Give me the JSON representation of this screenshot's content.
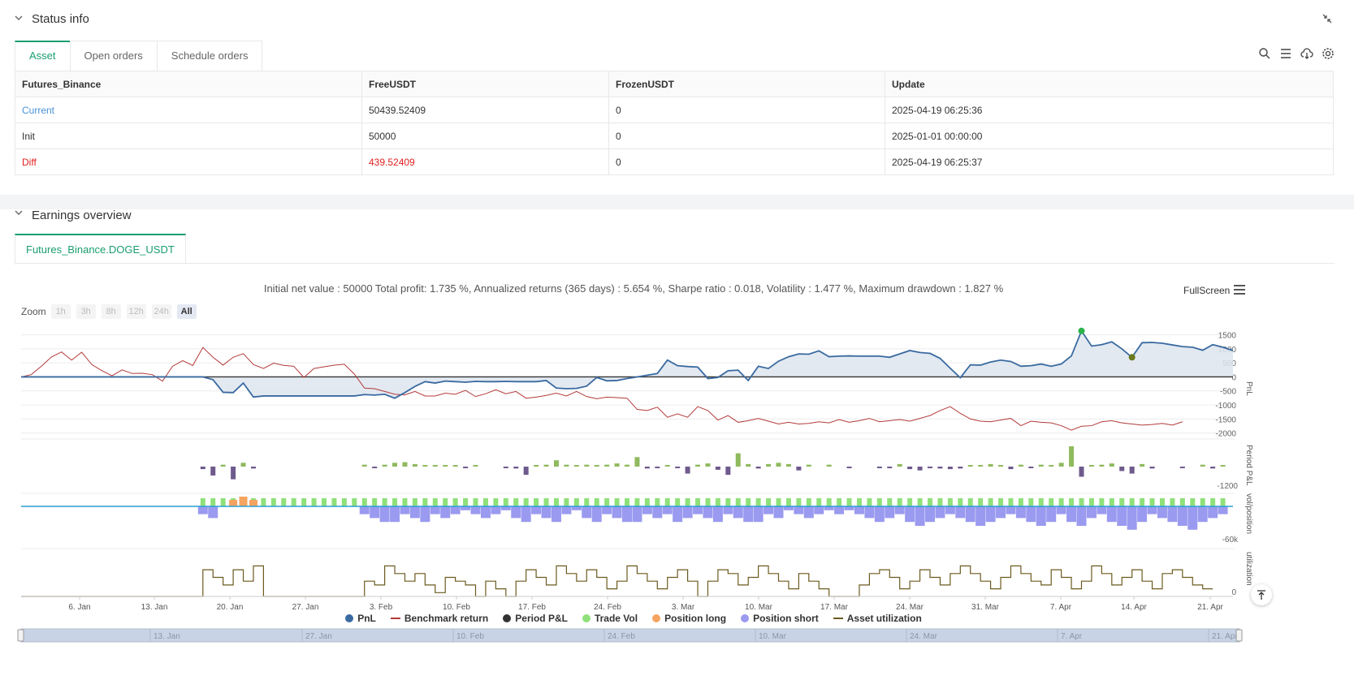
{
  "status": {
    "title": "Status info",
    "tabs": [
      "Asset",
      "Open orders",
      "Schedule orders"
    ],
    "table": {
      "headers": [
        "Futures_Binance",
        "FreeUSDT",
        "FrozenUSDT",
        "Update"
      ],
      "rows": [
        [
          "Current",
          "50439.52409",
          "0",
          "2025-04-19 06:25:36"
        ],
        [
          "Init",
          "50000",
          "0",
          "2025-01-01 00:00:00"
        ],
        [
          "Diff",
          "439.52409",
          "0",
          "2025-04-19 06:25:37"
        ]
      ]
    }
  },
  "earnings": {
    "title": "Earnings overview",
    "tab": "Futures_Binance.DOGE_USDT",
    "summary": "Initial net value : 50000 Total profit: 1.735 %, Annualized returns (365 days) : 5.654 %, Sharpe ratio : 0.018, Volatility : 1.477 %, Maximum drawdown : 1.827 %",
    "fullscreen": "FullScreen",
    "zoom_label": "Zoom",
    "zoom_buttons": [
      "1h",
      "3h",
      "8h",
      "12h",
      "24h",
      "All"
    ]
  },
  "chart_data": {
    "type": "line",
    "x_labels": [
      "6. Jan",
      "13. Jan",
      "20. Jan",
      "27. Jan",
      "3. Feb",
      "10. Feb",
      "17. Feb",
      "24. Feb",
      "3. Mar",
      "10. Mar",
      "17. Mar",
      "24. Mar",
      "31. Mar",
      "7. Apr",
      "14. Apr",
      "21. Apr"
    ],
    "navigator_labels": [
      "13. Jan",
      "27. Jan",
      "10. Feb",
      "24. Feb",
      "10. Mar",
      "24. Mar",
      "7. Apr",
      "21. Apr"
    ],
    "pnl_axis": {
      "ylabel": "PnL",
      "ticks": [
        1500,
        1000,
        500,
        0,
        -500,
        -1000,
        -1500,
        -2000
      ],
      "ylim": [
        -2100,
        1750
      ]
    },
    "period_axis": {
      "ylabel": "Period P&L",
      "ticks": [
        "-1200"
      ]
    },
    "vol_axis": {
      "ylabel": "vol/position",
      "ticks": [
        "-60k"
      ]
    },
    "util_axis": {
      "ylabel": "utilization",
      "ticks": [
        "0"
      ]
    },
    "pnl": [
      0,
      0,
      0,
      0,
      0,
      0,
      0,
      0,
      0,
      0,
      0,
      0,
      0,
      0,
      0,
      0,
      0,
      0,
      0,
      -100,
      -550,
      -560,
      -220,
      -720,
      -680,
      -680,
      -680,
      -680,
      -680,
      -680,
      -680,
      -680,
      -680,
      -680,
      -630,
      -650,
      -620,
      -760,
      -560,
      -340,
      -170,
      -220,
      -150,
      -170,
      -190,
      -160,
      -170,
      -170,
      -160,
      -170,
      -170,
      -170,
      -130,
      -400,
      -420,
      -410,
      -330,
      -20,
      -140,
      -130,
      -60,
      0,
      60,
      120,
      600,
      400,
      370,
      350,
      -60,
      -20,
      220,
      240,
      -130,
      380,
      300,
      560,
      720,
      820,
      810,
      930,
      720,
      740,
      750,
      740,
      740,
      740,
      700,
      820,
      940,
      870,
      840,
      660,
      310,
      -30,
      430,
      420,
      530,
      600,
      550,
      380,
      400,
      460,
      380,
      460,
      750,
      1640,
      1100,
      1150,
      1250,
      1000,
      700,
      1220,
      1230,
      1200,
      1140,
      1080,
      1060,
      950,
      1150,
      1060,
      940
    ],
    "benchmark": [
      0,
      80,
      380,
      710,
      890,
      600,
      880,
      440,
      220,
      40,
      250,
      120,
      130,
      80,
      -150,
      380,
      580,
      410,
      1050,
      700,
      420,
      700,
      830,
      440,
      300,
      490,
      410,
      380,
      -20,
      300,
      360,
      420,
      450,
      100,
      -400,
      -420,
      -520,
      -620,
      -640,
      -520,
      -680,
      -680,
      -580,
      -620,
      -480,
      -700,
      -600,
      -460,
      -600,
      -520,
      -760,
      -720,
      -660,
      -580,
      -680,
      -520,
      -700,
      -780,
      -720,
      -740,
      -760,
      -1160,
      -1200,
      -1080,
      -1440,
      -1320,
      -1440,
      -1060,
      -1200,
      -1540,
      -1380,
      -1620,
      -1560,
      -1480,
      -1580,
      -1680,
      -1620,
      -1680,
      -1660,
      -1600,
      -1640,
      -1520,
      -1620,
      -1560,
      -1480,
      -1600,
      -1560,
      -1520,
      -1580,
      -1480,
      -1380,
      -1200,
      -1060,
      -1300,
      -1500,
      -1580,
      -1600,
      -1540,
      -1480,
      -1740,
      -1580,
      -1620,
      -1640,
      -1740,
      -1900,
      -1760,
      -1740,
      -1600,
      -1560,
      -1640,
      -1680,
      -1720,
      -1700,
      -1660,
      -1720,
      -1600
    ],
    "period_pnl": [
      0,
      0,
      0,
      0,
      0,
      0,
      0,
      0,
      0,
      0,
      0,
      0,
      0,
      0,
      0,
      0,
      0,
      0,
      -80,
      -280,
      60,
      -400,
      120,
      -60,
      0,
      0,
      0,
      0,
      0,
      0,
      0,
      0,
      0,
      0,
      60,
      -40,
      60,
      120,
      140,
      80,
      40,
      40,
      40,
      40,
      -40,
      40,
      0,
      0,
      -20,
      -60,
      -260,
      40,
      60,
      200,
      60,
      40,
      60,
      40,
      60,
      100,
      60,
      300,
      -60,
      -40,
      30,
      -30,
      -220,
      60,
      100,
      -100,
      -260,
      420,
      80,
      -60,
      80,
      120,
      80,
      -120,
      60,
      0,
      60,
      0,
      -20,
      0,
      0,
      -20,
      -40,
      80,
      -80,
      -120,
      -40,
      -60,
      -80,
      -60,
      40,
      20,
      80,
      40,
      -80,
      60,
      -20,
      60,
      20,
      120,
      640,
      -320,
      30,
      60,
      100,
      -140,
      -220,
      80,
      -60,
      0,
      0,
      -40,
      0,
      60,
      -60,
      40
    ],
    "trade_vol": [
      0,
      0,
      0,
      0,
      0,
      0,
      0,
      0,
      0,
      0,
      0,
      0,
      0,
      0,
      0,
      0,
      0,
      0,
      1,
      1,
      1,
      1,
      1,
      1,
      1,
      1,
      1,
      1,
      1,
      1,
      1,
      1,
      1,
      1,
      1,
      1,
      1,
      1,
      1,
      1,
      1,
      1,
      1,
      1,
      1,
      1,
      1,
      1,
      1,
      1,
      1,
      1,
      1,
      1,
      1,
      1,
      1,
      1,
      1,
      1,
      1,
      1,
      1,
      1,
      1,
      1,
      1,
      1,
      1,
      1,
      1,
      1,
      1,
      1,
      1,
      1,
      1,
      1,
      1,
      1,
      1,
      1,
      1,
      1,
      1,
      1,
      1,
      1,
      1,
      1,
      1,
      1,
      1,
      1,
      1,
      1,
      1,
      1,
      1,
      1,
      1,
      1,
      1,
      1,
      1,
      1,
      1,
      1,
      1,
      1,
      1,
      1,
      1,
      1,
      1,
      1,
      1,
      1,
      1,
      1
    ],
    "position_long": [
      0,
      0,
      0,
      0,
      0,
      0,
      0,
      0,
      0,
      0,
      0,
      0,
      0,
      0,
      0,
      0,
      0,
      0,
      0,
      0,
      0,
      20,
      30,
      20,
      0,
      0,
      0,
      0,
      0,
      0,
      0,
      0,
      0,
      0,
      0,
      0,
      0,
      0,
      0,
      0,
      0,
      0,
      0,
      0,
      0,
      0,
      0,
      0,
      0,
      0,
      0,
      0,
      0,
      0,
      0,
      0,
      0,
      0,
      0,
      0,
      0,
      0,
      0,
      0,
      0,
      0,
      0,
      0,
      0,
      0,
      0,
      0,
      0,
      0,
      0,
      0,
      0,
      0,
      0,
      0,
      0,
      0,
      0,
      0,
      0,
      0,
      0,
      0,
      0,
      0,
      0,
      0,
      0,
      0,
      0,
      0,
      0,
      0,
      0,
      0,
      0,
      0,
      0,
      0,
      0,
      0,
      0,
      0,
      0,
      0,
      0,
      0,
      0,
      0,
      0,
      0,
      0,
      0,
      0,
      0
    ],
    "position_short": [
      0,
      0,
      0,
      0,
      0,
      0,
      0,
      0,
      0,
      0,
      0,
      0,
      0,
      0,
      0,
      0,
      0,
      0,
      -20,
      -30,
      0,
      0,
      0,
      0,
      0,
      0,
      0,
      0,
      0,
      0,
      0,
      0,
      0,
      0,
      -20,
      -30,
      -40,
      -40,
      -20,
      -30,
      -40,
      -20,
      -30,
      -20,
      -10,
      -20,
      -30,
      -20,
      -10,
      -30,
      -40,
      -20,
      -30,
      -40,
      -20,
      -10,
      -30,
      -40,
      -20,
      -30,
      -40,
      -40,
      -20,
      -30,
      -20,
      -40,
      -30,
      -20,
      -30,
      -40,
      -20,
      -30,
      -40,
      -40,
      -20,
      -30,
      -10,
      -20,
      -30,
      -20,
      -10,
      -20,
      -10,
      -20,
      -30,
      -40,
      -30,
      -20,
      -40,
      -50,
      -40,
      -30,
      -20,
      -30,
      -40,
      -50,
      -40,
      -30,
      -20,
      -30,
      -40,
      -50,
      -40,
      -20,
      -40,
      -50,
      -30,
      -20,
      -40,
      -50,
      -60,
      -40,
      -20,
      -30,
      -40,
      -50,
      -60,
      -40,
      -30,
      -20
    ],
    "asset_util": [
      0,
      0,
      0,
      0,
      0,
      0,
      0,
      0,
      0,
      0,
      0,
      0,
      0,
      0,
      0,
      0,
      0,
      0,
      0.7,
      0.5,
      0.3,
      0.7,
      0.4,
      0.8,
      0,
      0,
      0,
      0,
      0,
      0,
      0,
      0,
      0,
      0,
      0.4,
      0.3,
      0.8,
      0.6,
      0.4,
      0.6,
      0.3,
      0.1,
      0.5,
      0.4,
      0.3,
      0,
      0.4,
      0.2,
      0,
      0.4,
      0.7,
      0.5,
      0.3,
      0.8,
      0.6,
      0.4,
      0.7,
      0.5,
      0.2,
      0.4,
      0.8,
      0.6,
      0.4,
      0.2,
      0.5,
      0.7,
      0.4,
      0,
      0.4,
      0.7,
      0.6,
      0.3,
      0.5,
      0.8,
      0.6,
      0.4,
      0.2,
      0.6,
      0.4,
      0.2,
      0,
      0,
      0,
      0.3,
      0.6,
      0.7,
      0.5,
      0.2,
      0.4,
      0.7,
      0.5,
      0.3,
      0.6,
      0.8,
      0.6,
      0.4,
      0.2,
      0.5,
      0.8,
      0.6,
      0.4,
      0.3,
      0.7,
      0.5,
      0.2,
      0.4,
      0.8,
      0.6,
      0.3,
      0.5,
      0.7,
      0.4,
      0.2,
      0.6,
      0.7,
      0.5,
      0.3,
      0.2
    ],
    "legend": [
      "PnL",
      "Benchmark return",
      "Period P&L",
      "Trade Vol",
      "Position long",
      "Position short",
      "Asset utilization"
    ],
    "colors": {
      "pnl": "#3a6aa0",
      "pnl_fill": "#dde5ef",
      "benchmark": "#b33a3a",
      "period_pos": "#8fba5e",
      "period_neg": "#6e5a8c",
      "trade_vol": "#8fe07a",
      "position_long": "#f4a460",
      "position_short": "#9a9af0",
      "utilization": "#6b5a1e",
      "zero_line": "#2a9fd6",
      "legend_dark": "#333333",
      "navigator": "#c8d4e6"
    }
  }
}
